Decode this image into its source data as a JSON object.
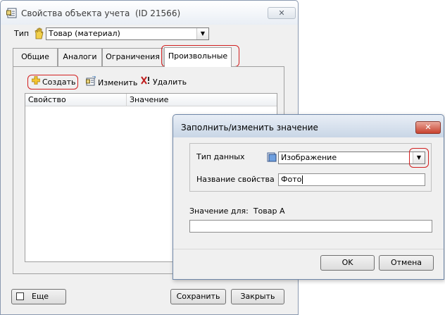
{
  "main_window": {
    "title": "Свойства объекта учета",
    "title_id": "(ID 21566)",
    "close_glyph": "✕",
    "type_label": "Тип",
    "type_value": "Товар (материал)",
    "tabs": [
      "Общие",
      "Аналоги",
      "Ограничения",
      "Произвольные"
    ],
    "active_tab": "Произвольные",
    "toolbar": {
      "create": "Создать",
      "edit": "Изменить",
      "delete": "Удалить"
    },
    "grid_columns": [
      "Свойство",
      "Значение"
    ],
    "more_checkbox_label": "Еще",
    "more_checked": false,
    "save_button": "Сохранить",
    "close_button": "Закрыть"
  },
  "dialog": {
    "title": "Заполнить/изменить значение",
    "close_glyph": "✕",
    "data_type_label": "Тип данных",
    "data_type_value": "Изображение",
    "property_name_label": "Название свойства",
    "property_name_value": "Фото",
    "value_for_label": "Значение для:",
    "value_for_object": "Товар А",
    "value_input": "",
    "ok_button": "OK",
    "cancel_button": "Отмена"
  },
  "colors": {
    "window_bg": "#f0f0f0",
    "highlight_red": "#d22020",
    "dialog_close_red": "#c8422f"
  },
  "icons": [
    "properties-icon",
    "hand-type-icon",
    "plus-icon",
    "edit-icon",
    "delete-icon",
    "image-type-icon",
    "dropdown-arrow-icon",
    "close-icon"
  ]
}
